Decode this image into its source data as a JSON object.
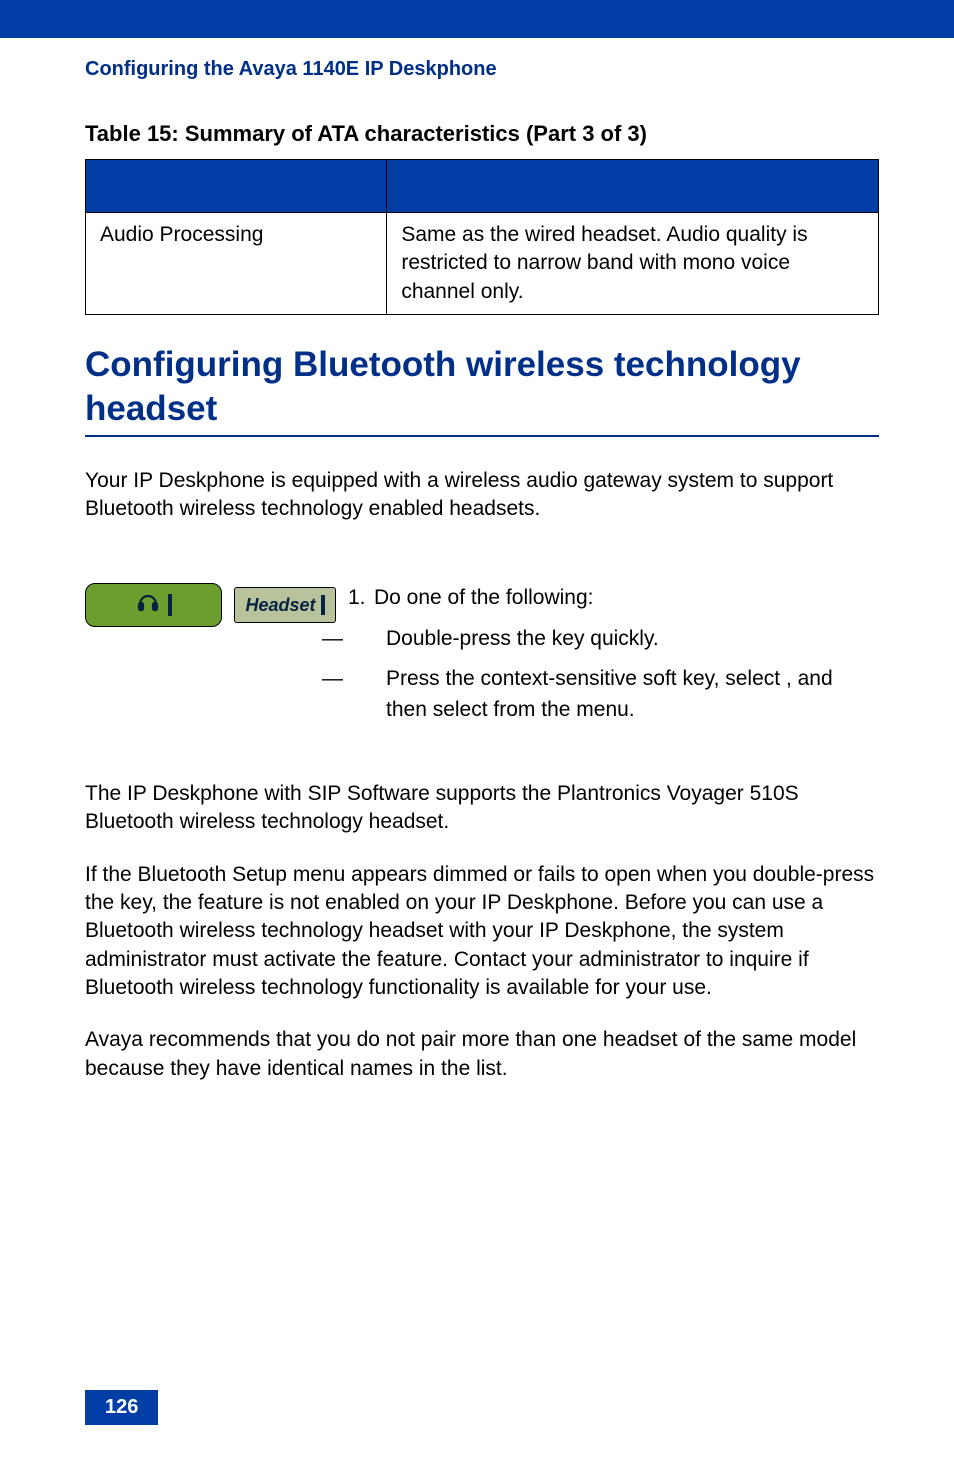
{
  "running_head": "Configuring the Avaya 1140E IP Deskphone",
  "table": {
    "caption": "Table 15: Summary of ATA characteristics (Part 3 of 3)",
    "row": {
      "left": "Audio Processing",
      "right": "Same as the wired headset. Audio quality is restricted to narrow band with mono voice channel only."
    }
  },
  "section_title": "Configuring Bluetooth wireless technology headset",
  "intro": "Your IP Deskphone is equipped with a wireless audio gateway system to support Bluetooth wireless technology enabled headsets.",
  "softkey_label": "Headset",
  "step": {
    "num": "1.",
    "lead": "Do one of the following:",
    "a_pre": "Double-press the ",
    "a_post": " key quickly.",
    "b_pre": "Press the ",
    "b_mid1": " context-sensitive soft key, select ",
    "b_mid2": ", and then select ",
    "b_post": " from the menu."
  },
  "para2": "The IP Deskphone with SIP Software supports the Plantronics Voyager 510S Bluetooth wireless technology headset.",
  "para3_pre": "If the Bluetooth Setup menu appears dimmed or fails to open when you double-press the ",
  "para3_post": " key, the feature is not enabled on your IP Deskphone. Before you can use a Bluetooth wireless technology headset with your IP Deskphone, the system administrator must activate the feature. Contact your administrator to inquire if Bluetooth wireless technology functionality is available for your use.",
  "para4_pre": " Avaya recommends that you do not pair more than one headset of the same model because they have identical names in the ",
  "para4_post": " list.",
  "page_num": "126"
}
